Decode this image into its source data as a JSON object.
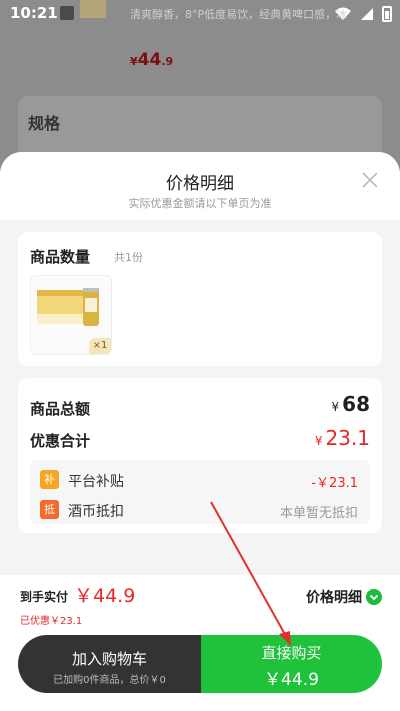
{
  "status_bar": {
    "time": "10:21"
  },
  "background": {
    "product_desc": "清爽醇香，8°P低度易饮，经典黄啤口感，冰",
    "price_symbol": "¥",
    "price_main": "44",
    "price_decimal": ".9",
    "spec_label": "规格"
  },
  "sheet": {
    "title": "价格明细",
    "subtitle": "实际优惠金额请以下单页为准",
    "quantity": {
      "title": "商品数量",
      "count": "共1份",
      "badge": "×1"
    },
    "summary": {
      "total_label": "商品总额",
      "total_yen": "¥",
      "total_value": "68",
      "discount_label": "优惠合计",
      "discount_yen": "¥",
      "discount_value": "23.1",
      "items": [
        {
          "icon_text": "补",
          "label": "平台补贴",
          "value": "-￥23.1"
        },
        {
          "icon_text": "抵",
          "label": "酒币抵扣",
          "value": "本单暂无抵扣"
        }
      ]
    }
  },
  "footer": {
    "pay_label": "到手实付",
    "pay_amount": "￥44.9",
    "saved_text": "已优惠￥23.1",
    "detail_toggle": "价格明细",
    "cart_button": {
      "label": "加入购物车",
      "sub": "已加购0件商品，总价￥0"
    },
    "buy_button": {
      "label": "直接购买",
      "price": "￥44.9"
    }
  },
  "colors": {
    "accent_green": "#1fc23a",
    "price_red": "#e52828",
    "subsidy_orange": "#f5a623",
    "deduct_orange": "#f26b2c"
  },
  "icons": [
    "wifi-icon",
    "signal-icon",
    "battery-icon",
    "close-icon",
    "chevron-down-icon"
  ]
}
